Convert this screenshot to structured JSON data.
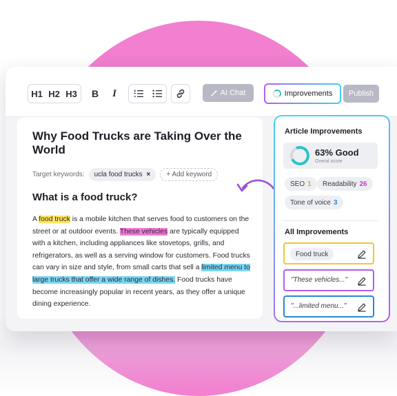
{
  "toolbar": {
    "headings": [
      "H1",
      "H2",
      "H3"
    ],
    "bold_label": "B",
    "italic_label": "I",
    "ai_chat_label": "AI Chat",
    "improvements_label": "Improvements",
    "publish_label": "Publish"
  },
  "editor": {
    "title": "Why Food Trucks are Taking Over the World",
    "target_keywords_label": "Target keywords:",
    "keyword_chip": "ucla food trucks",
    "add_keyword_label": "+ Add keyword",
    "section_heading": "What is a food truck?",
    "paragraph": {
      "p1": "A ",
      "h1": "food truck",
      "p2": " is a mobile kitchen that serves food to customers on the street or at outdoor events. ",
      "h2": "These vehicles",
      "p3": " are typically equipped with a kitchen, including appliances like stovetops, grills, and refrigerators, as well as a serving window for customers. Food trucks can vary in size and style, from small carts that sell a ",
      "h3": "limited menu to large trucks that offer a wide range of dishes.",
      "p4": " Food trucks have become increasingly popular in recent years, as they offer a unique dining experience."
    }
  },
  "panel": {
    "title": "Article Improvements",
    "score_value": "63% Good",
    "score_label": "Overal score",
    "score_fraction": 0.63,
    "metrics": [
      {
        "label": "SEO",
        "value": "1",
        "color": "#e8a21a"
      },
      {
        "label": "Readability",
        "value": "26",
        "color": "#c53fd0"
      },
      {
        "label": "Tone of voice",
        "value": "3",
        "color": "#2a86d6"
      }
    ],
    "all_title": "All Improvements",
    "items": [
      {
        "text": "Food truck",
        "border": "#f4c430"
      },
      {
        "text": "\"These vehicles...\"",
        "border": "#b25cf0"
      },
      {
        "text": "\"...limited menu...\"",
        "border": "#2a86d6"
      }
    ]
  },
  "colors": {
    "background_circle": "#f27fd0",
    "accent_teal": "#2ac4c4",
    "highlight_yellow": "#ffe45c",
    "highlight_pink": "#f07bd6",
    "highlight_blue": "#7cd6f2"
  }
}
